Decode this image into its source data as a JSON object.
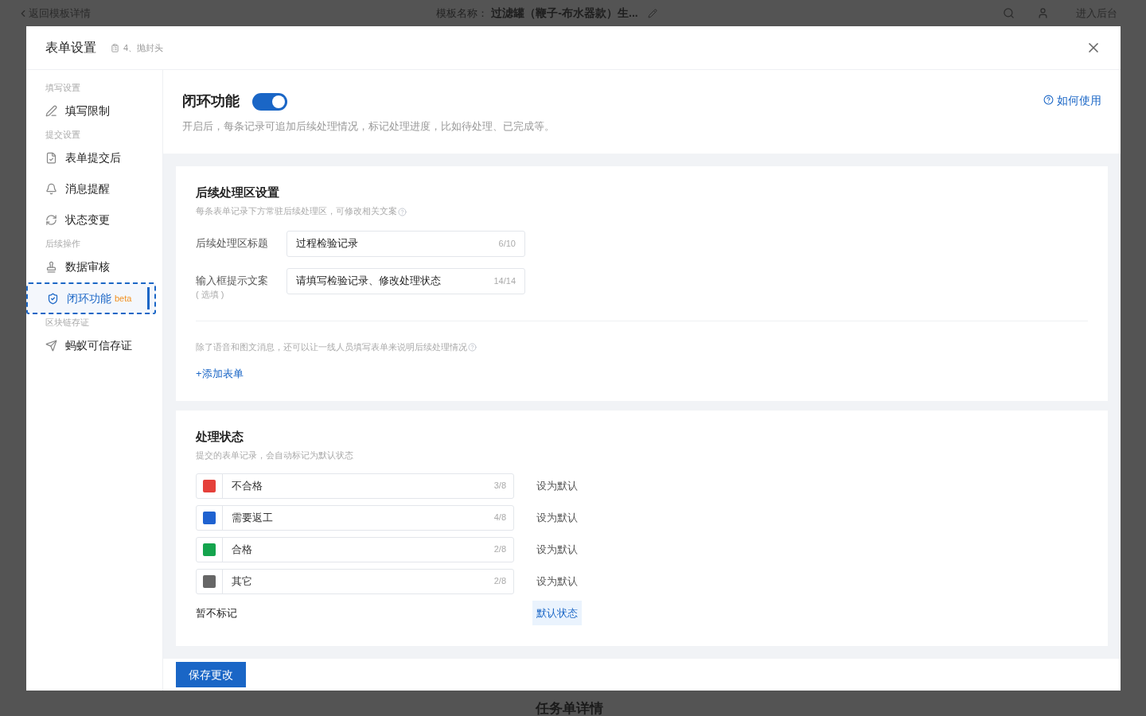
{
  "background_page": {
    "back_link": "返回模板详情",
    "template_label": "模板名称：",
    "template_name": "过滤罐（鞭子-布水器款）生...",
    "enter_admin": "进入后台",
    "section_title": "任务单详情"
  },
  "modal": {
    "title": "表单设置",
    "breadcrumb": "4、抛封头",
    "sidebar": [
      {
        "label": "填写设置",
        "items": [
          {
            "label": "填写限制",
            "selected": false
          }
        ]
      },
      {
        "label": "提交设置",
        "items": [
          {
            "label": "表单提交后",
            "selected": false
          },
          {
            "label": "消息提醒",
            "selected": false
          },
          {
            "label": "状态变更",
            "selected": false
          }
        ]
      },
      {
        "label": "后续操作",
        "items": [
          {
            "label": "数据审核",
            "selected": false
          },
          {
            "label": "闭环功能",
            "badge": "beta",
            "selected": true
          }
        ]
      },
      {
        "label": "区块链存证",
        "items": [
          {
            "label": "蚂蚁可信存证",
            "selected": false
          }
        ]
      }
    ],
    "feature": {
      "title": "闭环功能",
      "on": true,
      "description": "开启后，每条记录可追加后续处理情况，标记处理进度，比如待处理、已完成等。",
      "help_link": "如何使用"
    },
    "followup_section": {
      "title": "后续处理区设置",
      "hint": "每条表单记录下方常驻后续处理区，可修改相关文案",
      "fields": [
        {
          "label": "后续处理区标题",
          "value": "过程检验记录",
          "count": "6/10"
        },
        {
          "label": "输入框提示文案",
          "sublabel": "( 选填 )",
          "value": "请填写检验记录、修改处理状态",
          "count": "14/14"
        }
      ],
      "note": "除了语音和图文消息，还可以让一线人员填写表单来说明后续处理情况",
      "add_link": "+添加表单"
    },
    "status_section": {
      "title": "处理状态",
      "hint": "提交的表单记录，会自动标记为默认状态",
      "statuses": [
        {
          "color": "#e5403a",
          "label": "不合格",
          "count": "3/8",
          "action": "设为默认",
          "default": false
        },
        {
          "color": "#1f62d0",
          "label": "需要返工",
          "count": "4/8",
          "action": "设为默认",
          "default": false
        },
        {
          "color": "#14a44d",
          "label": "合格",
          "count": "2/8",
          "action": "设为默认",
          "default": false
        },
        {
          "color": "#666666",
          "label": "其它",
          "count": "2/8",
          "action": "设为默认",
          "default": false
        }
      ],
      "no_mark": {
        "label": "暂不标记",
        "action": "默认状态",
        "default": true
      }
    },
    "save_button": "保存更改"
  }
}
